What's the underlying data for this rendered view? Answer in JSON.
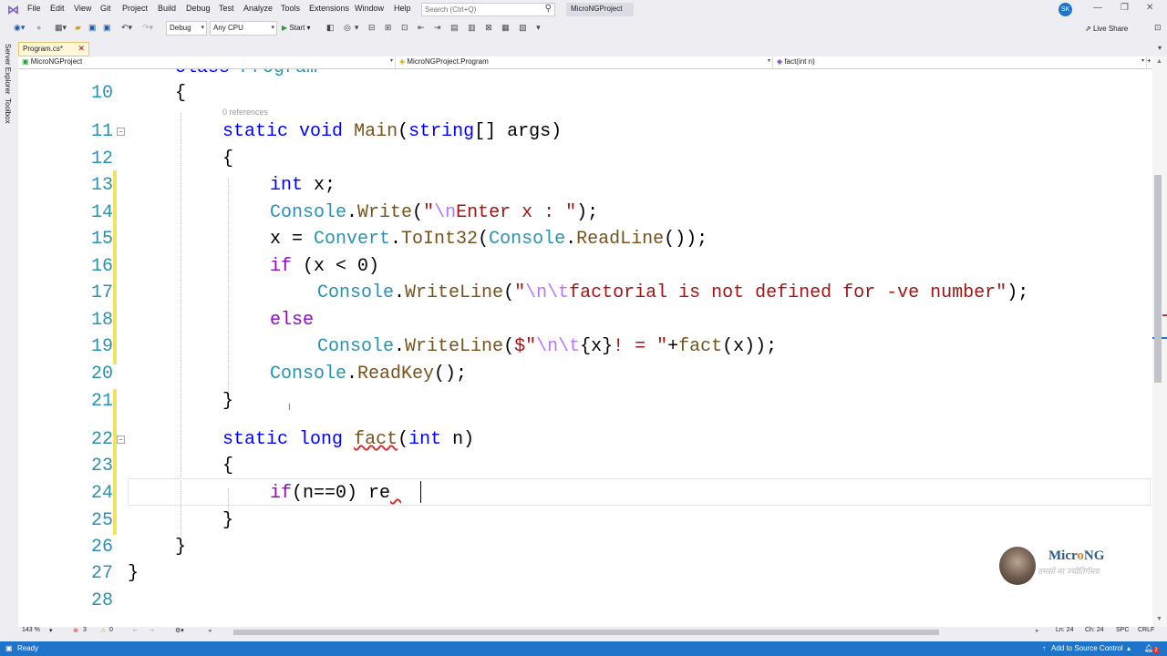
{
  "menubar": {
    "items": [
      "File",
      "Edit",
      "View",
      "Git",
      "Project",
      "Build",
      "Debug",
      "Test",
      "Analyze",
      "Tools",
      "Extensions",
      "Window",
      "Help"
    ],
    "search_placeholder": "Search (Ctrl+Q)",
    "project_name": "MicroNGProject",
    "user_initials": "SK"
  },
  "toolbar": {
    "config": "Debug",
    "platform": "Any CPU",
    "start_label": "Start",
    "live_share": "Live Share"
  },
  "side_tabs": [
    "Server Explorer",
    "Toolbox"
  ],
  "tab": {
    "label": "Program.cs*"
  },
  "navbar": {
    "project": "MicroNGProject",
    "type": "MicroNGProject.Program",
    "member": "fact(int n)"
  },
  "editor": {
    "partial_top": "class Program",
    "references_label": "0 references",
    "line_numbers": [
      "10",
      "11",
      "12",
      "13",
      "14",
      "15",
      "16",
      "17",
      "18",
      "19",
      "20",
      "21",
      "22",
      "23",
      "24",
      "25",
      "26",
      "27",
      "28"
    ]
  },
  "scroll_status": {
    "zoom": "143 %",
    "errors": "3",
    "warnings": "0",
    "line": "Ln: 24",
    "char": "Ch: 24",
    "spc": "SPC",
    "crlf": "CRLF"
  },
  "statusbar": {
    "ready": "Ready",
    "source_control": "Add to Source Control",
    "notifications": "2"
  },
  "brand": {
    "name_prefix": "Micr",
    "name_o": "o",
    "name_suffix": "NG",
    "tagline": "तमसो मा ज्योतिर्गमय"
  },
  "colors": {
    "keyword": "#0000ff",
    "type": "#2b91af",
    "method": "#74531f",
    "string": "#a31515",
    "escape": "#b776fb",
    "control": "#8f08c4",
    "statusbar": "#1d74c9"
  }
}
